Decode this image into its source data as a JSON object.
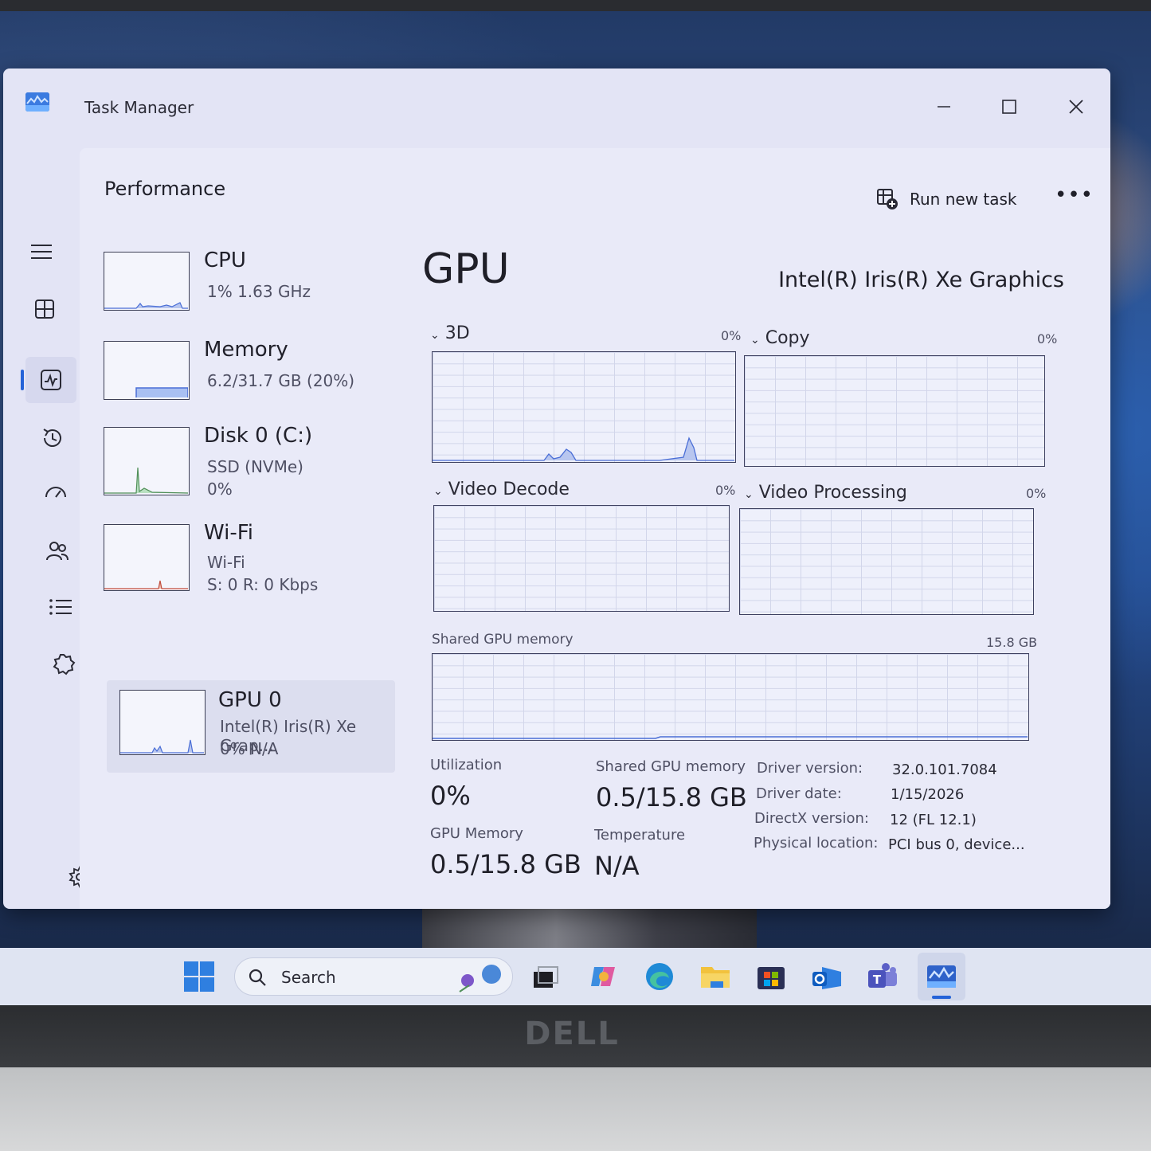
{
  "window": {
    "title": "Task Manager"
  },
  "header": {
    "page_title": "Performance",
    "run_new_task": "Run new task",
    "more": "•••"
  },
  "nav": {
    "items": [
      "menu-icon",
      "processes-icon",
      "performance-icon",
      "app-history-icon",
      "startup-apps-icon",
      "users-icon",
      "details-icon",
      "services-icon",
      "settings-icon"
    ],
    "active": "performance-icon"
  },
  "resources": [
    {
      "name": "CPU",
      "line1": "1%  1.63 GHz",
      "line2": ""
    },
    {
      "name": "Memory",
      "line1": "6.2/31.7 GB (20%)",
      "line2": ""
    },
    {
      "name": "Disk 0 (C:)",
      "line1": "SSD (NVMe)",
      "line2": "0%"
    },
    {
      "name": "Wi-Fi",
      "line1": "Wi-Fi",
      "line2": "S: 0  R: 0 Kbps"
    },
    {
      "name": "GPU 0",
      "line1": "Intel(R) Iris(R) Xe Grap...",
      "line2": "0%  N/A"
    }
  ],
  "selected_resource": "GPU 0",
  "detail": {
    "title": "GPU",
    "model": "Intel(R) Iris(R) Xe Graphics",
    "graphs": [
      {
        "label": "3D",
        "pct": "0%"
      },
      {
        "label": "Copy",
        "pct": "0%"
      },
      {
        "label": "Video Decode",
        "pct": "0%"
      },
      {
        "label": "Video Processing",
        "pct": "0%"
      }
    ],
    "shared_memory_graph": {
      "label": "Shared GPU memory",
      "max": "15.8 GB"
    },
    "stats": {
      "utilization_label": "Utilization",
      "utilization_value": "0%",
      "shared_mem_label": "Shared GPU memory",
      "shared_mem_value": "0.5/15.8 GB",
      "gpu_mem_label": "GPU Memory",
      "gpu_mem_value": "0.5/15.8 GB",
      "temp_label": "Temperature",
      "temp_value": "N/A"
    },
    "info": [
      {
        "label": "Driver version:",
        "value": "32.0.101.7084"
      },
      {
        "label": "Driver date:",
        "value": "1/15/2026"
      },
      {
        "label": "DirectX version:",
        "value": "12 (FL 12.1)"
      },
      {
        "label": "Physical location:",
        "value": "PCI bus 0, device..."
      }
    ]
  },
  "taskbar": {
    "search_placeholder": "Search",
    "apps": [
      "start-icon",
      "task-view-icon",
      "copilot-icon",
      "edge-icon",
      "file-explorer-icon",
      "store-icon",
      "outlook-icon",
      "teams-icon",
      "task-manager-icon"
    ],
    "active_app": "task-manager-icon"
  },
  "brand": "DELL",
  "colors": {
    "accent": "#2563d8",
    "graph_line": "#4a6ed6",
    "window_bg": "#e3e4f5"
  }
}
